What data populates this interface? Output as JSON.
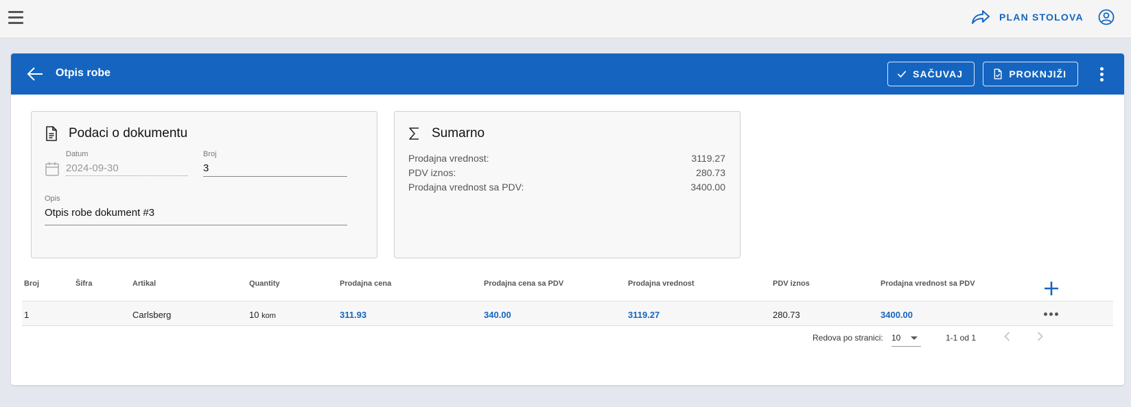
{
  "topbar": {
    "plan_label": "PLAN STOLOVA"
  },
  "toolbar": {
    "title": "Otpis robe",
    "save_label": "SAČUVAJ",
    "post_label": "PROKNJIŽI"
  },
  "document": {
    "title": "Podaci o dokumentu",
    "date_label": "Datum",
    "date_value": "2024-09-30",
    "number_label": "Broj",
    "number_value": "3",
    "description_label": "Opis",
    "description_value": "Otpis robe dokument #3"
  },
  "summary": {
    "title": "Sumarno",
    "rows": [
      {
        "label": "Prodajna vrednost:",
        "value": "3119.27"
      },
      {
        "label": "PDV iznos:",
        "value": "280.73"
      },
      {
        "label": "Prodajna vrednost sa PDV:",
        "value": "3400.00"
      }
    ]
  },
  "table": {
    "headers": [
      "Broj",
      "Šifra",
      "Artikal",
      "Quantity",
      "Prodajna cena",
      "Prodajna cena sa PDV",
      "Prodajna vrednost",
      "PDV iznos",
      "Prodajna vrednost sa PDV"
    ],
    "rows": [
      {
        "broj": "1",
        "sifra": "",
        "artikal": "Carlsberg",
        "quantity": "10",
        "unit": "kom",
        "prodajna_cena": "311.93",
        "prodajna_cena_pdv": "340.00",
        "prodajna_vrednost": "3119.27",
        "pdv_iznos": "280.73",
        "prodajna_vrednost_pdv": "3400.00"
      }
    ]
  },
  "pagination": {
    "rows_per_page_label": "Redova po stranici:",
    "rows_per_page": "10",
    "range": "1-1 od 1"
  },
  "colors": {
    "primary": "#1565c0",
    "topbar": "#f5f5f5",
    "background": "#e5e7ee"
  }
}
